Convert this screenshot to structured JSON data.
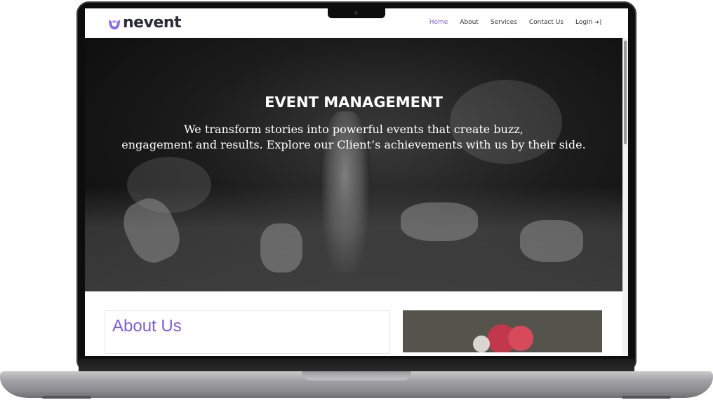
{
  "brand": {
    "name": "nevent",
    "accent": "#7b5fd6"
  },
  "nav": {
    "items": [
      {
        "label": "Home",
        "active": true
      },
      {
        "label": "About",
        "active": false
      },
      {
        "label": "Services",
        "active": false
      },
      {
        "label": "Contact Us",
        "active": false
      },
      {
        "label": "Login",
        "icon": "login-icon",
        "active": false
      }
    ]
  },
  "hero": {
    "title": "EVENT MANAGEMENT",
    "subtitle_line1": "We transform stories into powerful events that create buzz,",
    "subtitle_line2": "engagement and results. Explore our Client’s achievements with us by their side."
  },
  "about": {
    "title": "About Us"
  }
}
